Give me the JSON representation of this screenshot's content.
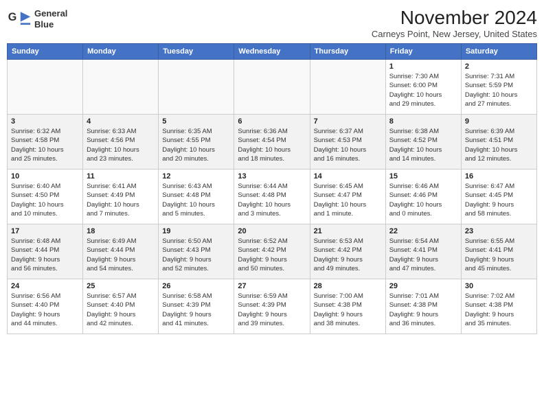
{
  "header": {
    "logo_line1": "General",
    "logo_line2": "Blue",
    "month": "November 2024",
    "location": "Carneys Point, New Jersey, United States"
  },
  "weekdays": [
    "Sunday",
    "Monday",
    "Tuesday",
    "Wednesday",
    "Thursday",
    "Friday",
    "Saturday"
  ],
  "weeks": [
    [
      {
        "day": "",
        "info": ""
      },
      {
        "day": "",
        "info": ""
      },
      {
        "day": "",
        "info": ""
      },
      {
        "day": "",
        "info": ""
      },
      {
        "day": "",
        "info": ""
      },
      {
        "day": "1",
        "info": "Sunrise: 7:30 AM\nSunset: 6:00 PM\nDaylight: 10 hours\nand 29 minutes."
      },
      {
        "day": "2",
        "info": "Sunrise: 7:31 AM\nSunset: 5:59 PM\nDaylight: 10 hours\nand 27 minutes."
      }
    ],
    [
      {
        "day": "3",
        "info": "Sunrise: 6:32 AM\nSunset: 4:58 PM\nDaylight: 10 hours\nand 25 minutes."
      },
      {
        "day": "4",
        "info": "Sunrise: 6:33 AM\nSunset: 4:56 PM\nDaylight: 10 hours\nand 23 minutes."
      },
      {
        "day": "5",
        "info": "Sunrise: 6:35 AM\nSunset: 4:55 PM\nDaylight: 10 hours\nand 20 minutes."
      },
      {
        "day": "6",
        "info": "Sunrise: 6:36 AM\nSunset: 4:54 PM\nDaylight: 10 hours\nand 18 minutes."
      },
      {
        "day": "7",
        "info": "Sunrise: 6:37 AM\nSunset: 4:53 PM\nDaylight: 10 hours\nand 16 minutes."
      },
      {
        "day": "8",
        "info": "Sunrise: 6:38 AM\nSunset: 4:52 PM\nDaylight: 10 hours\nand 14 minutes."
      },
      {
        "day": "9",
        "info": "Sunrise: 6:39 AM\nSunset: 4:51 PM\nDaylight: 10 hours\nand 12 minutes."
      }
    ],
    [
      {
        "day": "10",
        "info": "Sunrise: 6:40 AM\nSunset: 4:50 PM\nDaylight: 10 hours\nand 10 minutes."
      },
      {
        "day": "11",
        "info": "Sunrise: 6:41 AM\nSunset: 4:49 PM\nDaylight: 10 hours\nand 7 minutes."
      },
      {
        "day": "12",
        "info": "Sunrise: 6:43 AM\nSunset: 4:48 PM\nDaylight: 10 hours\nand 5 minutes."
      },
      {
        "day": "13",
        "info": "Sunrise: 6:44 AM\nSunset: 4:48 PM\nDaylight: 10 hours\nand 3 minutes."
      },
      {
        "day": "14",
        "info": "Sunrise: 6:45 AM\nSunset: 4:47 PM\nDaylight: 10 hours\nand 1 minute."
      },
      {
        "day": "15",
        "info": "Sunrise: 6:46 AM\nSunset: 4:46 PM\nDaylight: 10 hours\nand 0 minutes."
      },
      {
        "day": "16",
        "info": "Sunrise: 6:47 AM\nSunset: 4:45 PM\nDaylight: 9 hours\nand 58 minutes."
      }
    ],
    [
      {
        "day": "17",
        "info": "Sunrise: 6:48 AM\nSunset: 4:44 PM\nDaylight: 9 hours\nand 56 minutes."
      },
      {
        "day": "18",
        "info": "Sunrise: 6:49 AM\nSunset: 4:44 PM\nDaylight: 9 hours\nand 54 minutes."
      },
      {
        "day": "19",
        "info": "Sunrise: 6:50 AM\nSunset: 4:43 PM\nDaylight: 9 hours\nand 52 minutes."
      },
      {
        "day": "20",
        "info": "Sunrise: 6:52 AM\nSunset: 4:42 PM\nDaylight: 9 hours\nand 50 minutes."
      },
      {
        "day": "21",
        "info": "Sunrise: 6:53 AM\nSunset: 4:42 PM\nDaylight: 9 hours\nand 49 minutes."
      },
      {
        "day": "22",
        "info": "Sunrise: 6:54 AM\nSunset: 4:41 PM\nDaylight: 9 hours\nand 47 minutes."
      },
      {
        "day": "23",
        "info": "Sunrise: 6:55 AM\nSunset: 4:41 PM\nDaylight: 9 hours\nand 45 minutes."
      }
    ],
    [
      {
        "day": "24",
        "info": "Sunrise: 6:56 AM\nSunset: 4:40 PM\nDaylight: 9 hours\nand 44 minutes."
      },
      {
        "day": "25",
        "info": "Sunrise: 6:57 AM\nSunset: 4:40 PM\nDaylight: 9 hours\nand 42 minutes."
      },
      {
        "day": "26",
        "info": "Sunrise: 6:58 AM\nSunset: 4:39 PM\nDaylight: 9 hours\nand 41 minutes."
      },
      {
        "day": "27",
        "info": "Sunrise: 6:59 AM\nSunset: 4:39 PM\nDaylight: 9 hours\nand 39 minutes."
      },
      {
        "day": "28",
        "info": "Sunrise: 7:00 AM\nSunset: 4:38 PM\nDaylight: 9 hours\nand 38 minutes."
      },
      {
        "day": "29",
        "info": "Sunrise: 7:01 AM\nSunset: 4:38 PM\nDaylight: 9 hours\nand 36 minutes."
      },
      {
        "day": "30",
        "info": "Sunrise: 7:02 AM\nSunset: 4:38 PM\nDaylight: 9 hours\nand 35 minutes."
      }
    ]
  ]
}
